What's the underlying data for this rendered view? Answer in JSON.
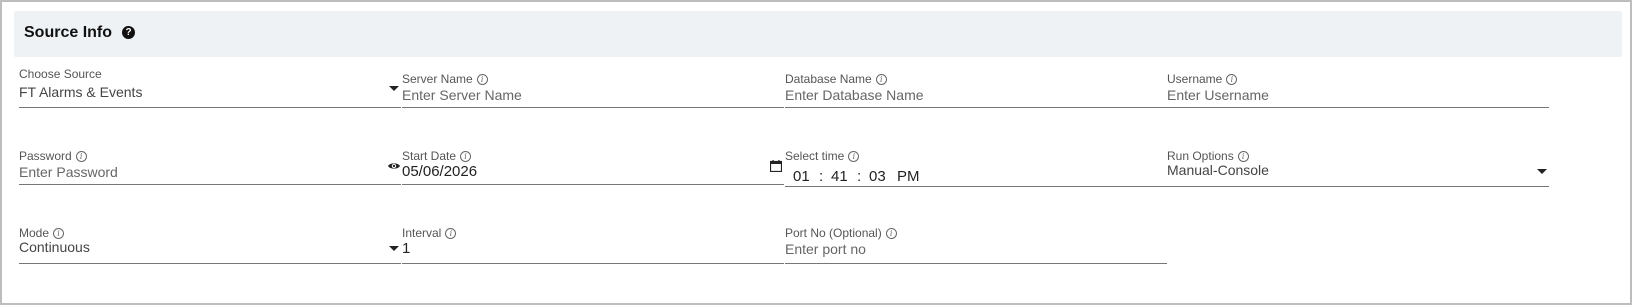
{
  "header": {
    "title": "Source Info",
    "help_glyph": "?"
  },
  "fields": {
    "source": {
      "label": "Choose Source",
      "value": "FT Alarms & Events"
    },
    "server": {
      "label": "Server Name",
      "placeholder": "Enter Server Name"
    },
    "database": {
      "label": "Database Name",
      "placeholder": "Enter Database Name"
    },
    "username": {
      "label": "Username",
      "placeholder": "Enter Username"
    },
    "password": {
      "label": "Password",
      "placeholder": "Enter Password"
    },
    "start_date": {
      "label": "Start Date",
      "value": "05/06/2026"
    },
    "select_time": {
      "label": "Select time",
      "hour": "01",
      "minute": "41",
      "second": "03",
      "ampm": "PM",
      "sep": ":"
    },
    "run_options": {
      "label": "Run Options",
      "value": "Manual-Console"
    },
    "mode": {
      "label": "Mode",
      "value": "Continuous"
    },
    "interval": {
      "label": "Interval",
      "value": "1"
    },
    "port": {
      "label": "Port No (Optional)",
      "placeholder": "Enter port no"
    }
  },
  "icons": {
    "help": "help-circle-icon",
    "info": "info-icon",
    "eye": "eye-icon",
    "calendar": "calendar-icon",
    "dropdown": "dropdown-caret-icon"
  }
}
